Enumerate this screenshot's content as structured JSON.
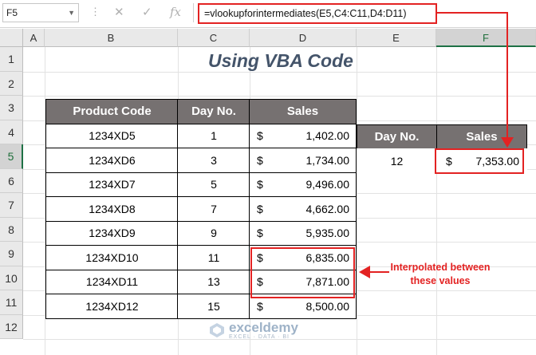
{
  "formula_bar": {
    "name_box": "F5",
    "cancel_icon": "✕",
    "enter_icon": "✓",
    "fx_icon": "fx",
    "formula": "=vlookupforintermediates(E5,C4:C11,D4:D11)"
  },
  "columns": [
    "A",
    "B",
    "C",
    "D",
    "E",
    "F"
  ],
  "rows": [
    "1",
    "2",
    "3",
    "4",
    "5",
    "6",
    "7",
    "8",
    "9",
    "10",
    "11",
    "12"
  ],
  "selected_cell": "F5",
  "title": "Using VBA Code",
  "table": {
    "headers": [
      "Product Code",
      "Day No.",
      "Sales"
    ],
    "rows": [
      {
        "code": "1234XD5",
        "day": "1",
        "cur": "$",
        "sales": "1,402.00"
      },
      {
        "code": "1234XD6",
        "day": "3",
        "cur": "$",
        "sales": "1,734.00"
      },
      {
        "code": "1234XD7",
        "day": "5",
        "cur": "$",
        "sales": "9,496.00"
      },
      {
        "code": "1234XD8",
        "day": "7",
        "cur": "$",
        "sales": "4,662.00"
      },
      {
        "code": "1234XD9",
        "day": "9",
        "cur": "$",
        "sales": "5,935.00"
      },
      {
        "code": "1234XD10",
        "day": "11",
        "cur": "$",
        "sales": "6,835.00"
      },
      {
        "code": "1234XD11",
        "day": "13",
        "cur": "$",
        "sales": "7,871.00"
      },
      {
        "code": "1234XD12",
        "day": "15",
        "cur": "$",
        "sales": "8,500.00"
      }
    ]
  },
  "lookup": {
    "headers": [
      "Day No.",
      "Sales"
    ],
    "day": "12",
    "cur": "$",
    "result": "7,353.00"
  },
  "annotation": [
    "Interpolated between",
    "these values"
  ],
  "watermark": {
    "name": "exceldemy",
    "tagline": "EXCEL · DATA · BI"
  },
  "colors": {
    "accent_red": "#e32222",
    "header_fill": "#767171",
    "title": "#44546a",
    "excel_green": "#1e7145"
  }
}
